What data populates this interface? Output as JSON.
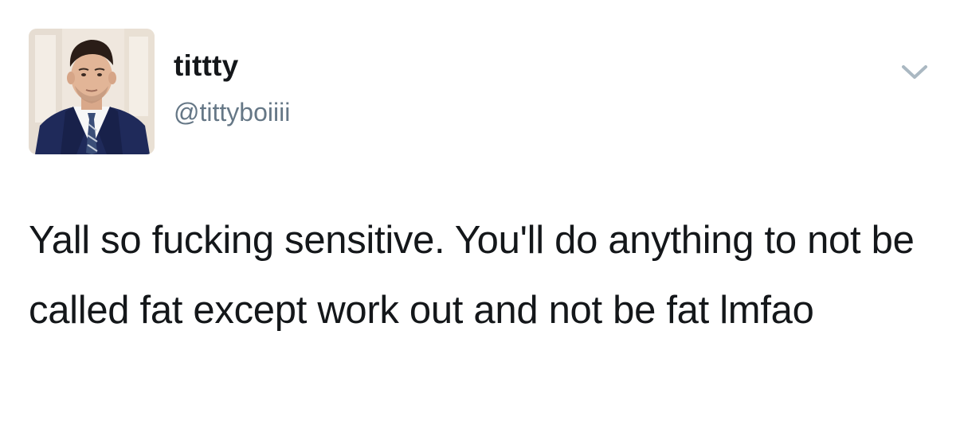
{
  "tweet": {
    "author": {
      "display_name": "tittty",
      "handle": "@tittyboiiii",
      "avatar_icon": "profile-photo"
    },
    "menu_icon": "chevron-down-icon",
    "text": "Yall so fucking sensitive. You'll do anything to not be called fat except work out and not be fat lmfao"
  },
  "colors": {
    "text_primary": "#14171a",
    "text_secondary": "#657786",
    "chevron": "#aab8c2",
    "background": "#ffffff"
  }
}
